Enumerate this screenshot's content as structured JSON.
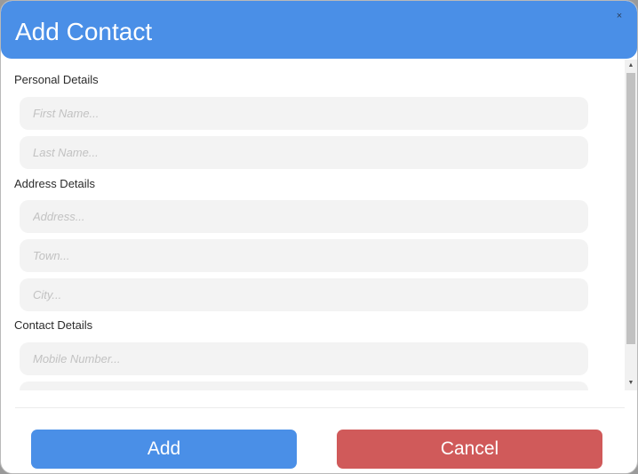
{
  "dialog": {
    "title": "Add Contact",
    "close_label": "×"
  },
  "sections": {
    "personal": {
      "label": "Personal Details",
      "first_name": {
        "value": "",
        "placeholder": "First Name..."
      },
      "last_name": {
        "value": "",
        "placeholder": "Last Name..."
      }
    },
    "address": {
      "label": "Address Details",
      "address": {
        "value": "",
        "placeholder": "Address..."
      },
      "town": {
        "value": "",
        "placeholder": "Town..."
      },
      "city": {
        "value": "",
        "placeholder": "City..."
      }
    },
    "contact": {
      "label": "Contact Details",
      "mobile": {
        "value": "",
        "placeholder": "Mobile Number..."
      },
      "next_field": {
        "value": "",
        "placeholder": ""
      }
    }
  },
  "scrollbar": {
    "up_icon": "▲",
    "down_icon": "▼"
  },
  "footer": {
    "add_label": "Add",
    "cancel_label": "Cancel"
  },
  "colors": {
    "header": "#4a8fe7",
    "add_button": "#4a8fe7",
    "cancel_button": "#d05a5a",
    "field_background": "#f3f3f3"
  }
}
